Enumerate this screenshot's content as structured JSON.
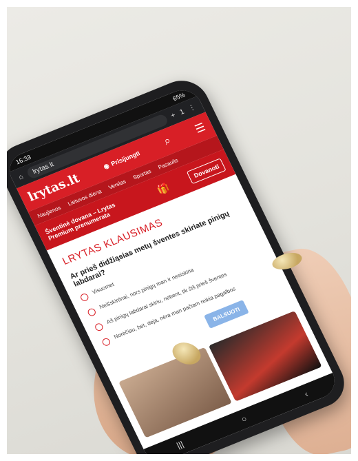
{
  "status": {
    "time": "16:33",
    "battery": "65%"
  },
  "browser": {
    "url": "lrytas.lt",
    "tab_count": "1"
  },
  "site": {
    "logo": "lrytas.lt",
    "login": "Prisijungti",
    "nav": [
      "Naujienos",
      "Lietuvos diena",
      "Verslas",
      "Sportas",
      "Pasaulis"
    ],
    "promo_text": "Šventinė dovana – Lrytas Premium prenumerata",
    "promo_button": "Dovanoti"
  },
  "quiz": {
    "title": "LRYTAS KLAUSIMAS",
    "question": "Ar prieš didžiąsias metų šventes skiriate pinigų labdarai?",
    "options": [
      "Visuomet",
      "Neišskirtinai, nors pinigų man ir nesiskiria",
      "Aš pinigų labdarai skiriu, nebent, tik šiš prieš šventes",
      "Norėčiau, bet, deja, nėra man pačiam reikia pagalbos"
    ],
    "vote_button": "BALSUOTI"
  }
}
